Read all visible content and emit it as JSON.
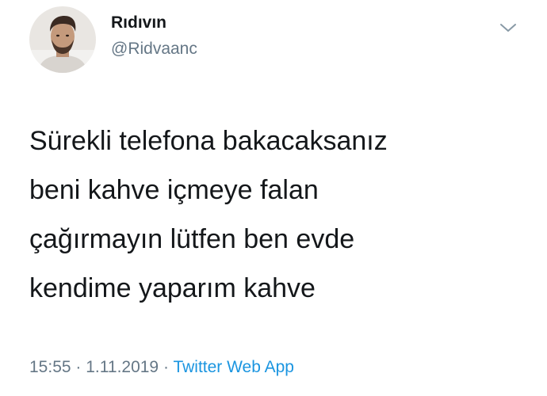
{
  "tweet": {
    "author": {
      "display_name": "Rıdıvın",
      "handle": "@Ridvaanc"
    },
    "menu_icon": "chevron-down-icon",
    "text_lines": [
      "Sürekli telefona bakacaksanız",
      "beni kahve içmeye falan",
      "çağırmayın lütfen ben evde",
      "kendime yaparım kahve"
    ],
    "time": "15:55",
    "separator": "·",
    "date": "1.11.2019",
    "source": "Twitter Web App"
  },
  "colors": {
    "text": "#14171a",
    "secondary": "#657786",
    "link": "#1b95e0"
  }
}
